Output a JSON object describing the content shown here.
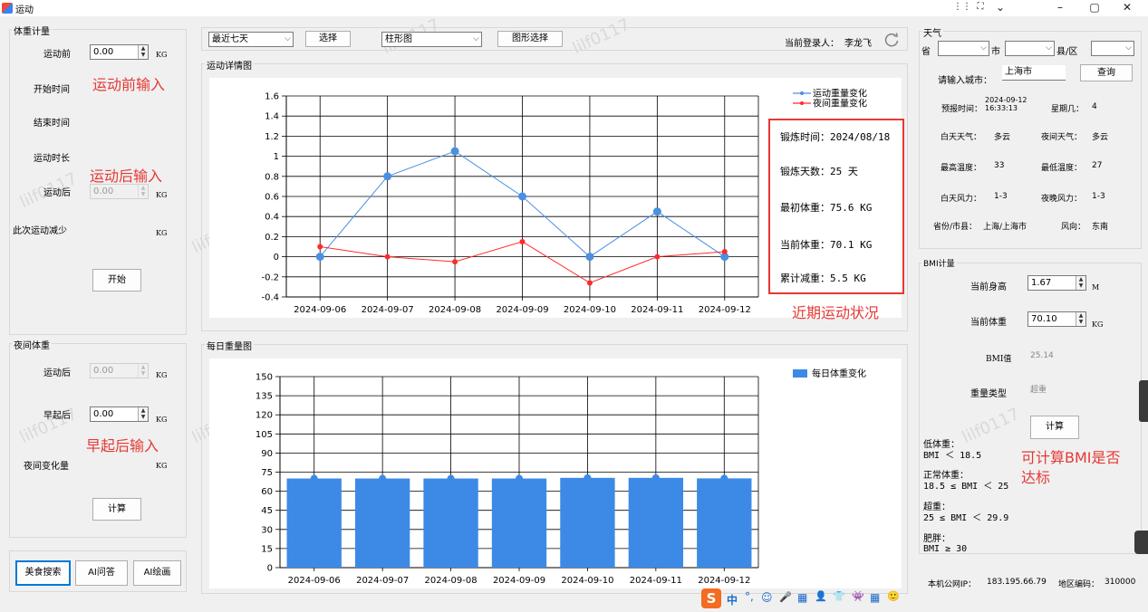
{
  "window": {
    "title": "运动",
    "controls": [
      "⋮⋮",
      "⛶",
      "⌄",
      "–",
      "▢",
      "✕"
    ]
  },
  "weight_panel": {
    "title": "体重计量",
    "before_label": "运动前",
    "before_value": "0.00",
    "unit": "KG",
    "start_time_label": "开始时间",
    "end_time_label": "结束时间",
    "duration_label": "运动时长",
    "after_label": "运动后",
    "after_value": "0.00",
    "reduce_label": "此次运动减少",
    "start_button": "开始",
    "note_before": "运动前输入",
    "note_after": "运动后输入"
  },
  "night_panel": {
    "title": "夜间体重",
    "after_label": "运动后",
    "after_value": "0.00",
    "morning_label": "早起后",
    "morning_value": "0.00",
    "change_label": "夜间变化量",
    "unit": "KG",
    "calc_button": "计算",
    "note_morning": "早起后输入"
  },
  "bottom_buttons": {
    "food": "美食搜索",
    "ai_qa": "AI问答",
    "ai_draw": "AI绘画"
  },
  "toolbar": {
    "range_select": "最近七天",
    "select_button": "选择",
    "chart_type_select": "柱形图",
    "chart_select_button": "图形选择",
    "login_label": "当前登录人：",
    "login_user": "李龙飞"
  },
  "detail_chart": {
    "group_title": "运动详情图",
    "info": {
      "time": "锻炼时间：2024/08/18",
      "days": "锻炼天数：25 天",
      "initial": "最初体重：75.6 KG",
      "current": "当前体重：70.1 KG",
      "total": "累计减重：5.5 KG"
    },
    "note": "近期运动状况"
  },
  "daily_chart": {
    "group_title": "每日重量图"
  },
  "chart_data": [
    {
      "type": "line",
      "categories": [
        "2024-09-06",
        "2024-09-07",
        "2024-09-08",
        "2024-09-09",
        "2024-09-10",
        "2024-09-11",
        "2024-09-12"
      ],
      "series": [
        {
          "name": "运动重量变化",
          "color": "#4a90e2",
          "values": [
            0,
            0.8,
            1.05,
            0.6,
            0,
            0.45,
            0
          ]
        },
        {
          "name": "夜间重量变化",
          "color": "#ff2a2a",
          "values": [
            0.1,
            0,
            -0.05,
            0.15,
            -0.26,
            0,
            0.05
          ]
        }
      ],
      "yticks": [
        "1.6",
        "1.4",
        "1.2",
        "1",
        "0.8",
        "0.6",
        "0.4",
        "0.2",
        "0",
        "-0.2",
        "-0.4"
      ],
      "ylim": [
        -0.4,
        1.6
      ],
      "legend": "top-right",
      "grid": true
    },
    {
      "type": "bar",
      "categories": [
        "2024-09-06",
        "2024-09-07",
        "2024-09-08",
        "2024-09-09",
        "2024-09-10",
        "2024-09-11",
        "2024-09-12"
      ],
      "series": [
        {
          "name": "每日体重变化",
          "color": "#3c8ae6",
          "values": [
            70,
            70,
            70,
            70,
            70.5,
            70.5,
            70.1
          ]
        }
      ],
      "yticks": [
        "150",
        "135",
        "120",
        "105",
        "90",
        "75",
        "60",
        "45",
        "30",
        "15",
        "0"
      ],
      "ylim": [
        0,
        150
      ],
      "legend": "top-right",
      "grid": true
    }
  ],
  "weather": {
    "title": "天气",
    "province_label": "省",
    "city_label": "市",
    "county_label": "县/区",
    "input_label": "请输入城市：",
    "city_value": "上海市",
    "query_button": "查询",
    "report_time_label": "预报时间：",
    "report_time_value": "2024-09-12\n16:33:13",
    "weekday_label": "星期几：",
    "weekday_value": "4",
    "day_weather_label": "白天天气：",
    "day_weather_value": "多云",
    "night_weather_label": "夜间天气：",
    "night_weather_value": "多云",
    "max_temp_label": "最高温度：",
    "max_temp_value": "33",
    "min_temp_label": "最低温度：",
    "min_temp_value": "27",
    "day_wind_label": "白天风力：",
    "day_wind_value": "1-3",
    "night_wind_label": "夜晚风力：",
    "night_wind_value": "1-3",
    "region_label": "省份/市县：",
    "region_value": "上海/上海市",
    "wind_dir_label": "风向：",
    "wind_dir_value": "东南"
  },
  "bmi": {
    "title": "BMI计量",
    "height_label": "当前身高",
    "height_value": "1.67",
    "height_unit": "M",
    "weight_label": "当前体重",
    "weight_value": "70.10",
    "weight_unit": "KG",
    "bmi_label": "BMI值",
    "bmi_value": "25.14",
    "type_label": "重量类型",
    "type_value": "超重",
    "calc_button": "计算",
    "note": "可计算BMI是否\n达标",
    "ranges": [
      {
        "name": "低体重：",
        "range": "BMI ＜ 18.5"
      },
      {
        "name": "正常体重：",
        "range": "18.5 ≤ BMI ＜ 25"
      },
      {
        "name": "超重：",
        "range": "25 ≤ BMI ＜ 29.9"
      },
      {
        "name": "肥胖：",
        "range": "BMI ≥ 30"
      }
    ]
  },
  "status": {
    "ip_label": "本机公网IP：",
    "ip_value": "183.195.66.79",
    "area_label": "地区编码：",
    "area_value": "310000"
  },
  "watermark_text": "lilf0117",
  "tray": [
    "S",
    "中",
    "°,",
    "☺",
    "🎤",
    "▦",
    "👤",
    "👕",
    "👾",
    "▦",
    "🙂"
  ]
}
